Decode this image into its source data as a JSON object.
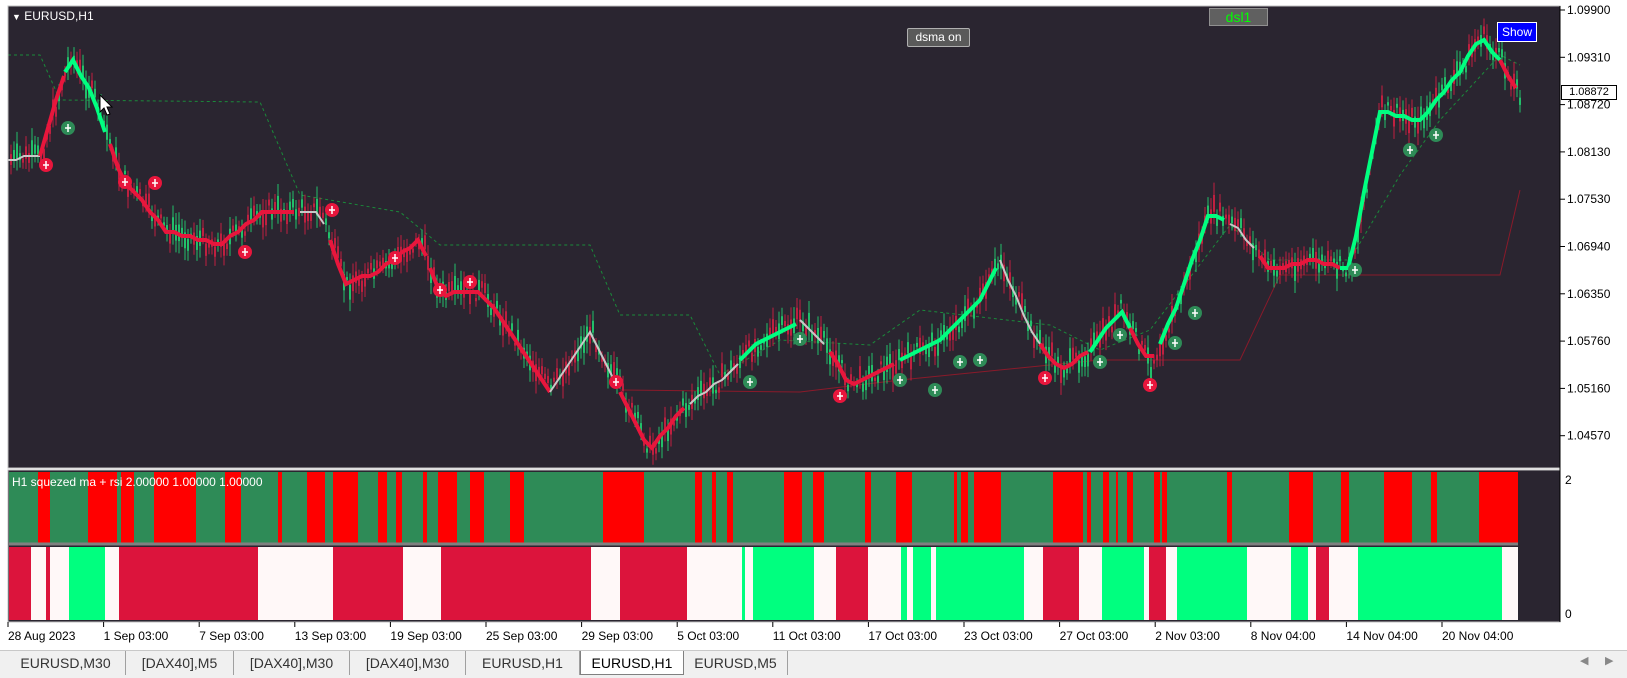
{
  "chart": {
    "symbol": "EURUSD,H1",
    "current_price": "1.08872",
    "price_ticks": [
      "1.09900",
      "1.09310",
      "1.08720",
      "1.08130",
      "1.07530",
      "1.06940",
      "1.06350",
      "1.05760",
      "1.05160",
      "1.04570"
    ],
    "date_labels": [
      "28 Aug 2023",
      "1 Sep 03:00",
      "7 Sep 03:00",
      "13 Sep 03:00",
      "19 Sep 03:00",
      "25 Sep 03:00",
      "29 Sep 03:00",
      "5 Oct 03:00",
      "11 Oct 03:00",
      "17 Oct 03:00",
      "23 Oct 03:00",
      "27 Oct 03:00",
      "2 Nov 03:00",
      "8 Nov 04:00",
      "14 Nov 04:00",
      "20 Nov 04:00"
    ],
    "colors": {
      "background": "#2a2530",
      "bull": "#00ff80",
      "bear": "#e8163c",
      "neutral": "#c8c8c8",
      "lower_green": "#2e8b57",
      "lower_red": "#ff0000",
      "strip_green": "#00ff7f",
      "strip_red": "#dc143c",
      "strip_white": "#fff8f8"
    }
  },
  "buttons": {
    "dsma": "dsma on",
    "dsl": "dsl1",
    "show": "Show"
  },
  "indicator": {
    "label": "H1 squezed ma + rsi  2.00000  1.00000  1.00000",
    "scale_top": "2",
    "scale_bottom": "0"
  },
  "tabs": [
    "EURUSD,M30",
    "[DAX40],M5",
    "[DAX40],M30",
    "[DAX40],M30",
    "EURUSD,H1",
    "EURUSD,H1",
    "EURUSD,M5"
  ],
  "active_tab": "EURUSD,H1",
  "icons": {
    "dropdown": "triangle-down-icon",
    "nav_left": "arrow-left-icon",
    "nav_right": "arrow-right-icon",
    "cursor": "mouse-pointer-icon"
  }
}
